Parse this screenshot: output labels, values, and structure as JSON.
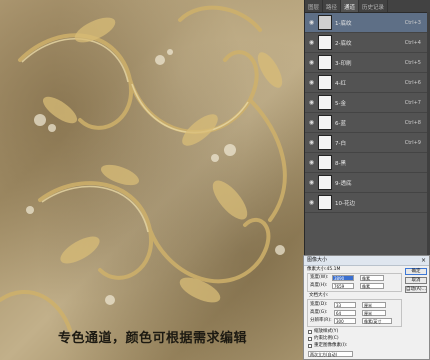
{
  "canvas": {
    "caption": "专色通道，颜色可根据需求编辑",
    "background_color": "#b09c74",
    "ornament_color": "#d6b870"
  },
  "channels_panel": {
    "tabs": [
      "图层",
      "路径",
      "通道",
      "历史记录"
    ],
    "active_tab": "通道",
    "channels": [
      {
        "name": "1-底纹",
        "shortcut": "Ctrl+3"
      },
      {
        "name": "2-底纹",
        "shortcut": "Ctrl+4"
      },
      {
        "name": "3-印刷",
        "shortcut": "Ctrl+5"
      },
      {
        "name": "4-红",
        "shortcut": "Ctrl+6"
      },
      {
        "name": "5-金",
        "shortcut": "Ctrl+7"
      },
      {
        "name": "6-蓝",
        "shortcut": "Ctrl+8"
      },
      {
        "name": "7-白",
        "shortcut": "Ctrl+9"
      },
      {
        "name": "8-黑",
        "shortcut": ""
      },
      {
        "name": "9-透底",
        "shortcut": ""
      },
      {
        "name": "10-花边",
        "shortcut": ""
      }
    ],
    "selected_index": 0,
    "accent": "#5e6f86"
  },
  "image_size_dialog": {
    "title": "图像大小",
    "pixel_dimensions_label": "像素大小:45.1M",
    "width_label": "宽度(W):",
    "width_value": "3890",
    "width_unit": "像素",
    "height_label": "高度(H):",
    "height_value": "7659",
    "height_unit": "像素",
    "document_size_label": "文档大小:",
    "doc_width_label": "宽度(D):",
    "doc_width_value": "33",
    "doc_width_unit": "厘米",
    "doc_height_label": "高度(G):",
    "doc_height_value": "64",
    "doc_height_unit": "厘米",
    "resolution_label": "分辨率(R):",
    "resolution_value": "300",
    "resolution_unit": "像素/英寸",
    "ok_button": "确定",
    "cancel_button": "取消",
    "auto_button": "自动(A)...",
    "checkbox_scale_styles": "缩放样式(Y)",
    "checkbox_constrain": "约束比例(C)",
    "checkbox_resample": "重定图像像素(I):",
    "resample_method": "两次立方(自动)"
  }
}
